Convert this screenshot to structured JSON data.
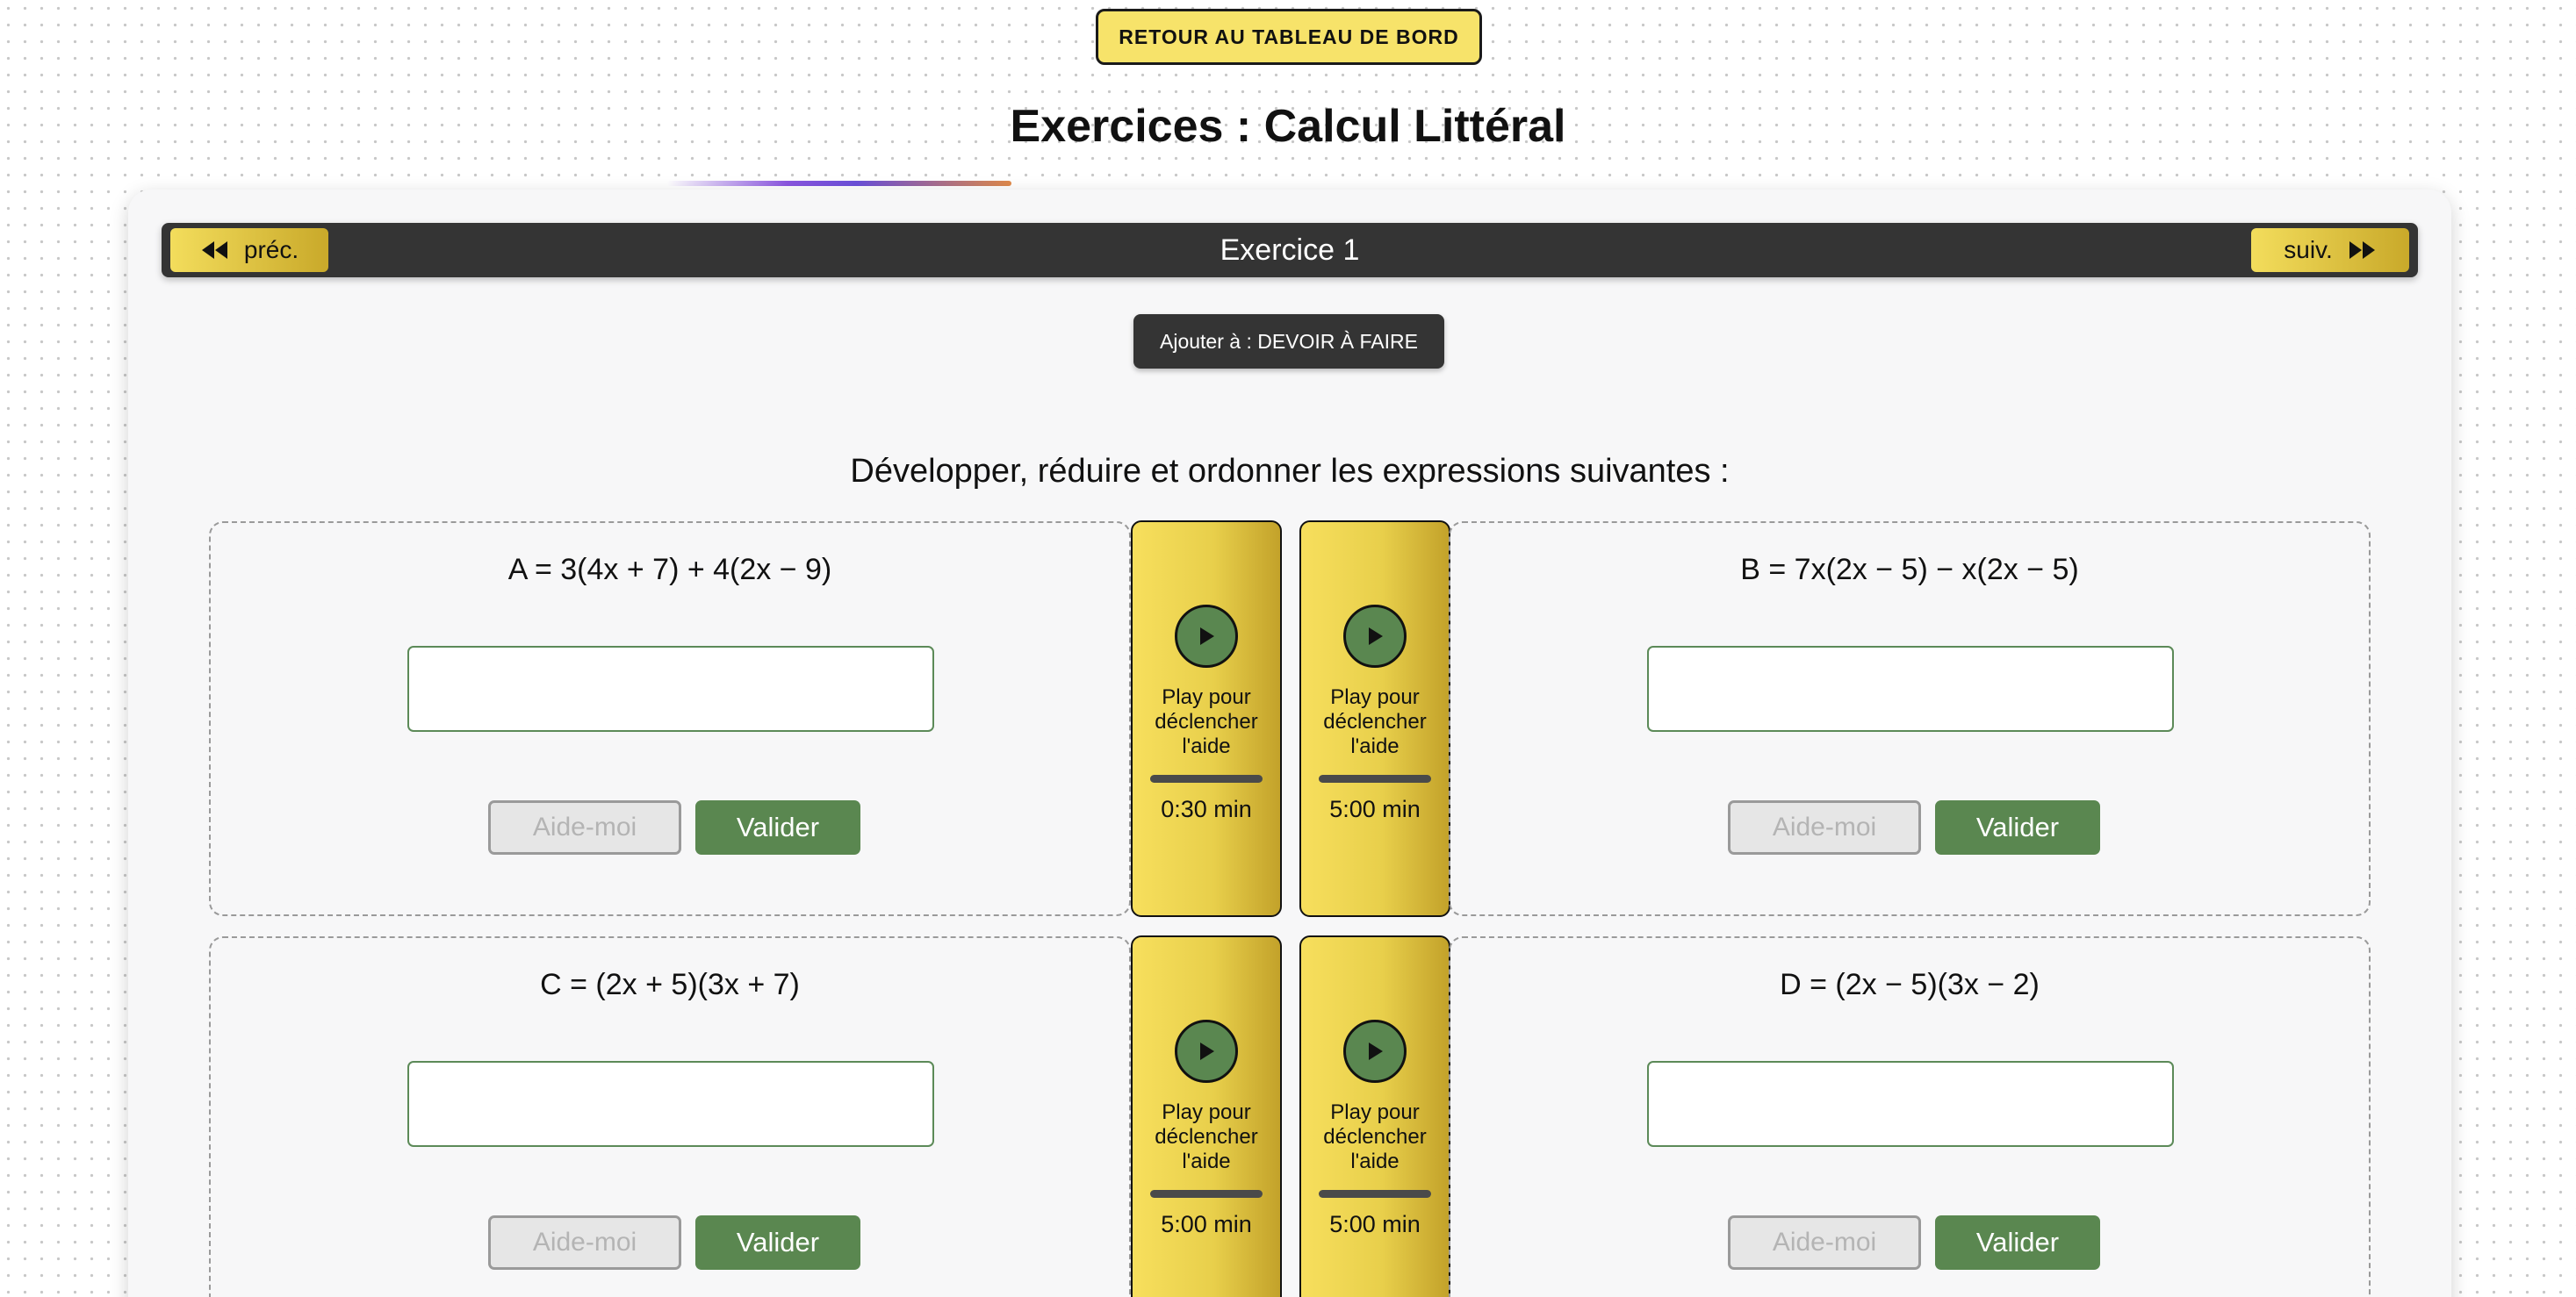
{
  "header": {
    "back_label": "RETOUR AU TABLEAU DE BORD",
    "title": "Exercices : Calcul Littéral"
  },
  "nav": {
    "prev_label": "préc.",
    "next_label": "suiv.",
    "exercise_title": "Exercice 1"
  },
  "devoir_label": "Ajouter à : DEVOIR À FAIRE",
  "instruction": "Développer, réduire et ordonner les expressions suivantes :",
  "exercises": [
    {
      "expression": "A = 3(4x + 7) + 4(2x − 9)",
      "answer": "",
      "aide_label": "Aide-moi",
      "valider_label": "Valider"
    },
    {
      "expression": "B = 7x(2x − 5) − x(2x − 5)",
      "answer": "",
      "aide_label": "Aide-moi",
      "valider_label": "Valider"
    },
    {
      "expression": "C = (2x + 5)(3x + 7)",
      "answer": "",
      "aide_label": "Aide-moi",
      "valider_label": "Valider"
    },
    {
      "expression": "D = (2x − 5)(3x − 2)",
      "answer": "",
      "aide_label": "Aide-moi",
      "valider_label": "Valider"
    }
  ],
  "aids": [
    {
      "text": "Play pour déclencher l'aide",
      "time": "0:30 min",
      "icon": "play-icon"
    },
    {
      "text": "Play pour déclencher l'aide",
      "time": "5:00 min",
      "icon": "play-icon"
    },
    {
      "text": "Play pour déclencher l'aide",
      "time": "5:00 min",
      "icon": "play-icon"
    },
    {
      "text": "Play pour déclencher l'aide",
      "time": "5:00 min",
      "icon": "play-icon"
    }
  ],
  "colors": {
    "accent_yellow": "#f7e36a",
    "dark_bar": "#343434",
    "valider_green": "#5a8750"
  }
}
